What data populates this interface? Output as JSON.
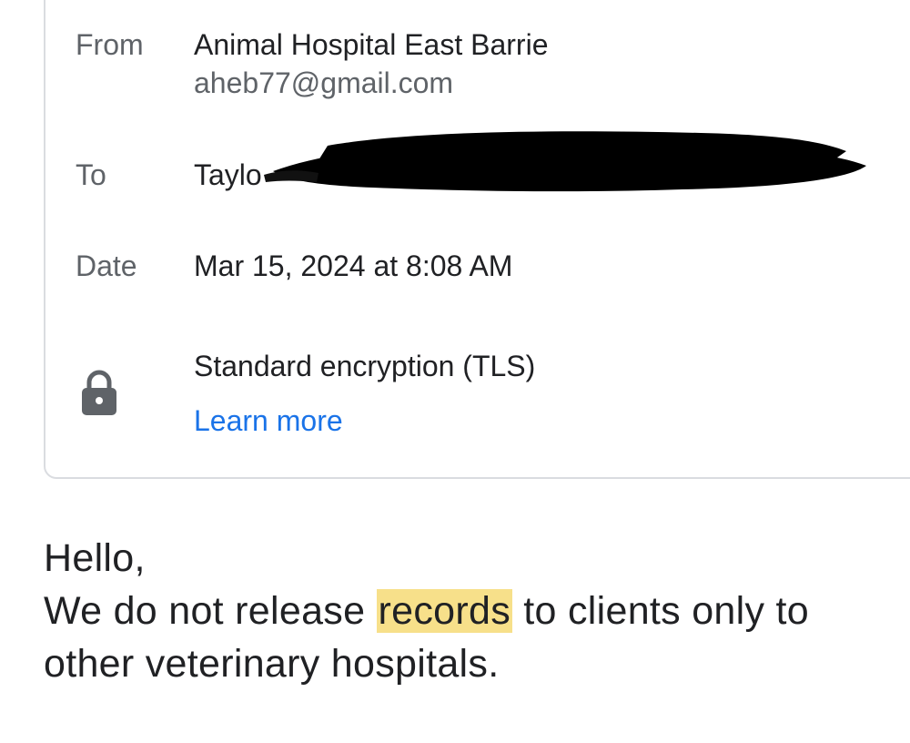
{
  "header": {
    "from_label": "From",
    "from_name": "Animal Hospital East Barrie",
    "from_email": "aheb77@gmail.com",
    "to_label": "To",
    "to_visible_text": "Taylo",
    "date_label": "Date",
    "date_value": "Mar 15, 2024 at 8:08 AM",
    "encryption_text": "Standard encryption (TLS)",
    "learn_more": "Learn more"
  },
  "icons": {
    "lock": "lock-icon"
  },
  "colors": {
    "link": "#1a73e8",
    "highlight": "#f7e08a",
    "card_border": "#dadce0",
    "label": "#5f6368"
  },
  "message": {
    "greeting": "Hello,",
    "line1_before": "We do not release ",
    "line1_highlight": "records",
    "line1_after": " to clients only to",
    "line2": "other veterinary hospitals."
  }
}
